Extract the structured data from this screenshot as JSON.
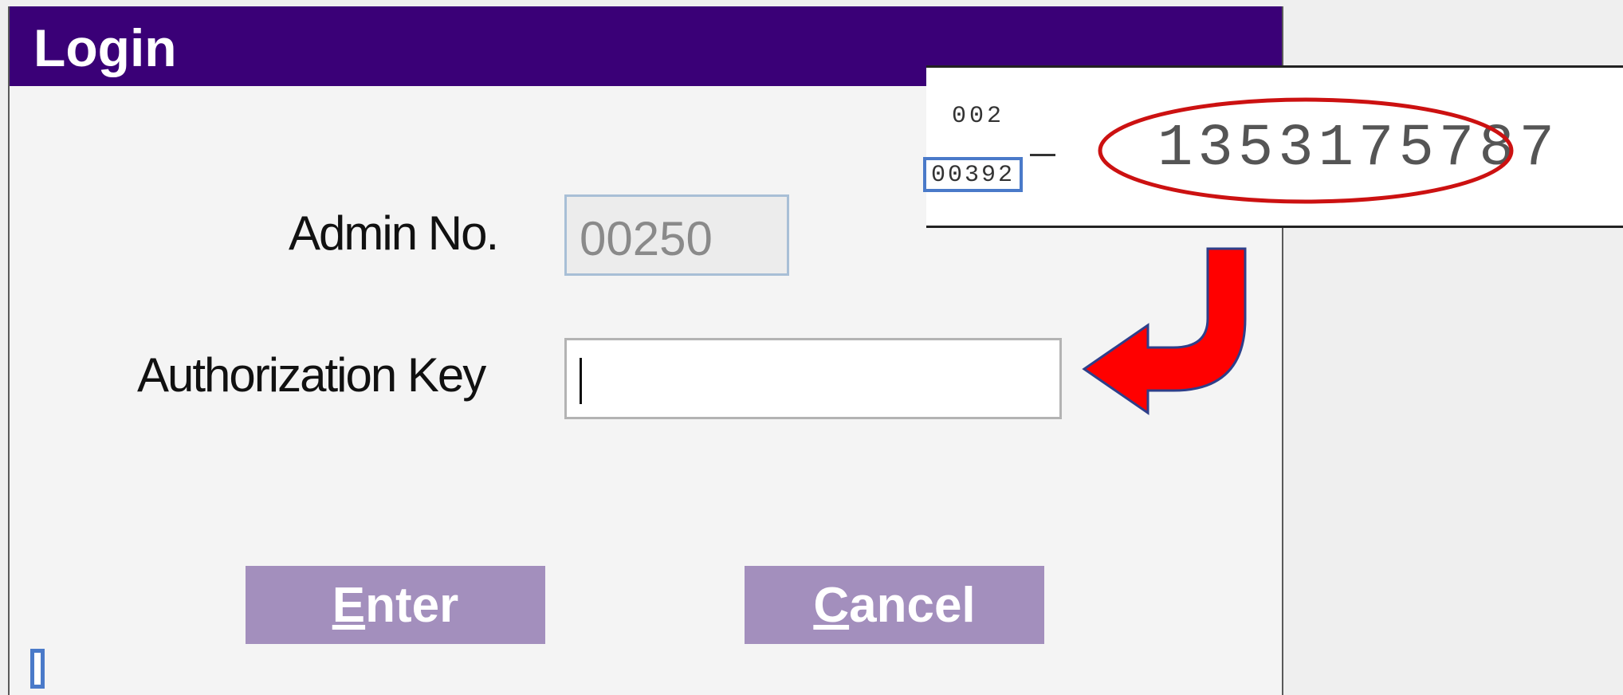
{
  "dialog": {
    "title": "Login",
    "admin": {
      "label": "Admin No.",
      "value": "00250"
    },
    "auth": {
      "label": "Authorization Key",
      "value": ""
    },
    "buttons": {
      "enter": {
        "mnemonic": "E",
        "rest": "nter"
      },
      "cancel": {
        "mnemonic": "C",
        "rest": "ancel"
      }
    }
  },
  "inset": {
    "top_code": "002",
    "boxed_code": "00392",
    "key_number": "1353175787"
  },
  "colors": {
    "titlebar": "#3a0077",
    "button": "#a38fbd",
    "highlight_circle": "#cc1111",
    "arrow": "#ff0000",
    "box_outline": "#4a7ac9"
  },
  "icons": {
    "arrow": "curved-arrow-pointing-left",
    "highlight": "red-ellipse"
  }
}
